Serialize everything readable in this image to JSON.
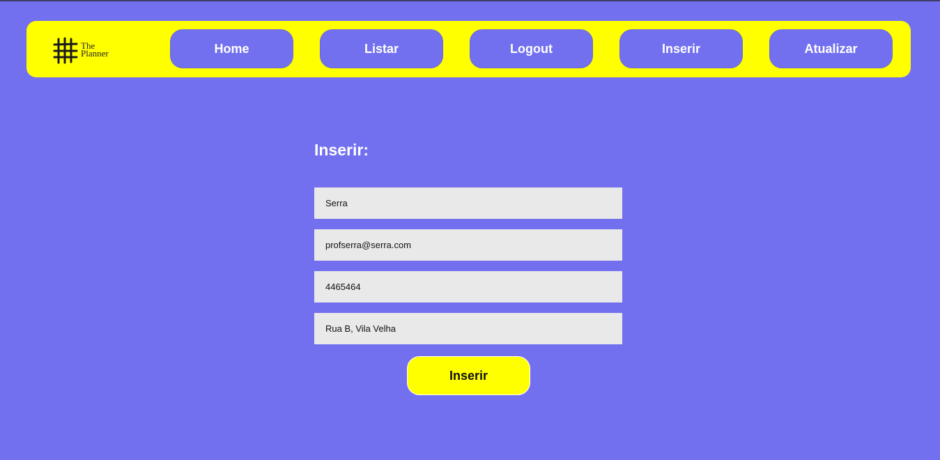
{
  "header": {
    "logo_line1": "The",
    "logo_line2": "Planner",
    "nav": [
      {
        "label": "Home"
      },
      {
        "label": "Listar"
      },
      {
        "label": "Logout"
      },
      {
        "label": "Inserir"
      },
      {
        "label": "Atualizar"
      }
    ]
  },
  "form": {
    "title": "Inserir:",
    "fields": [
      {
        "value": "Serra"
      },
      {
        "value": "profserra@serra.com"
      },
      {
        "value": "4465464"
      },
      {
        "value": "Rua B, Vila Velha"
      }
    ],
    "submit_label": "Inserir"
  },
  "colors": {
    "background": "#7270ee",
    "navbar": "#ffff00",
    "field": "#e9e9e9"
  }
}
